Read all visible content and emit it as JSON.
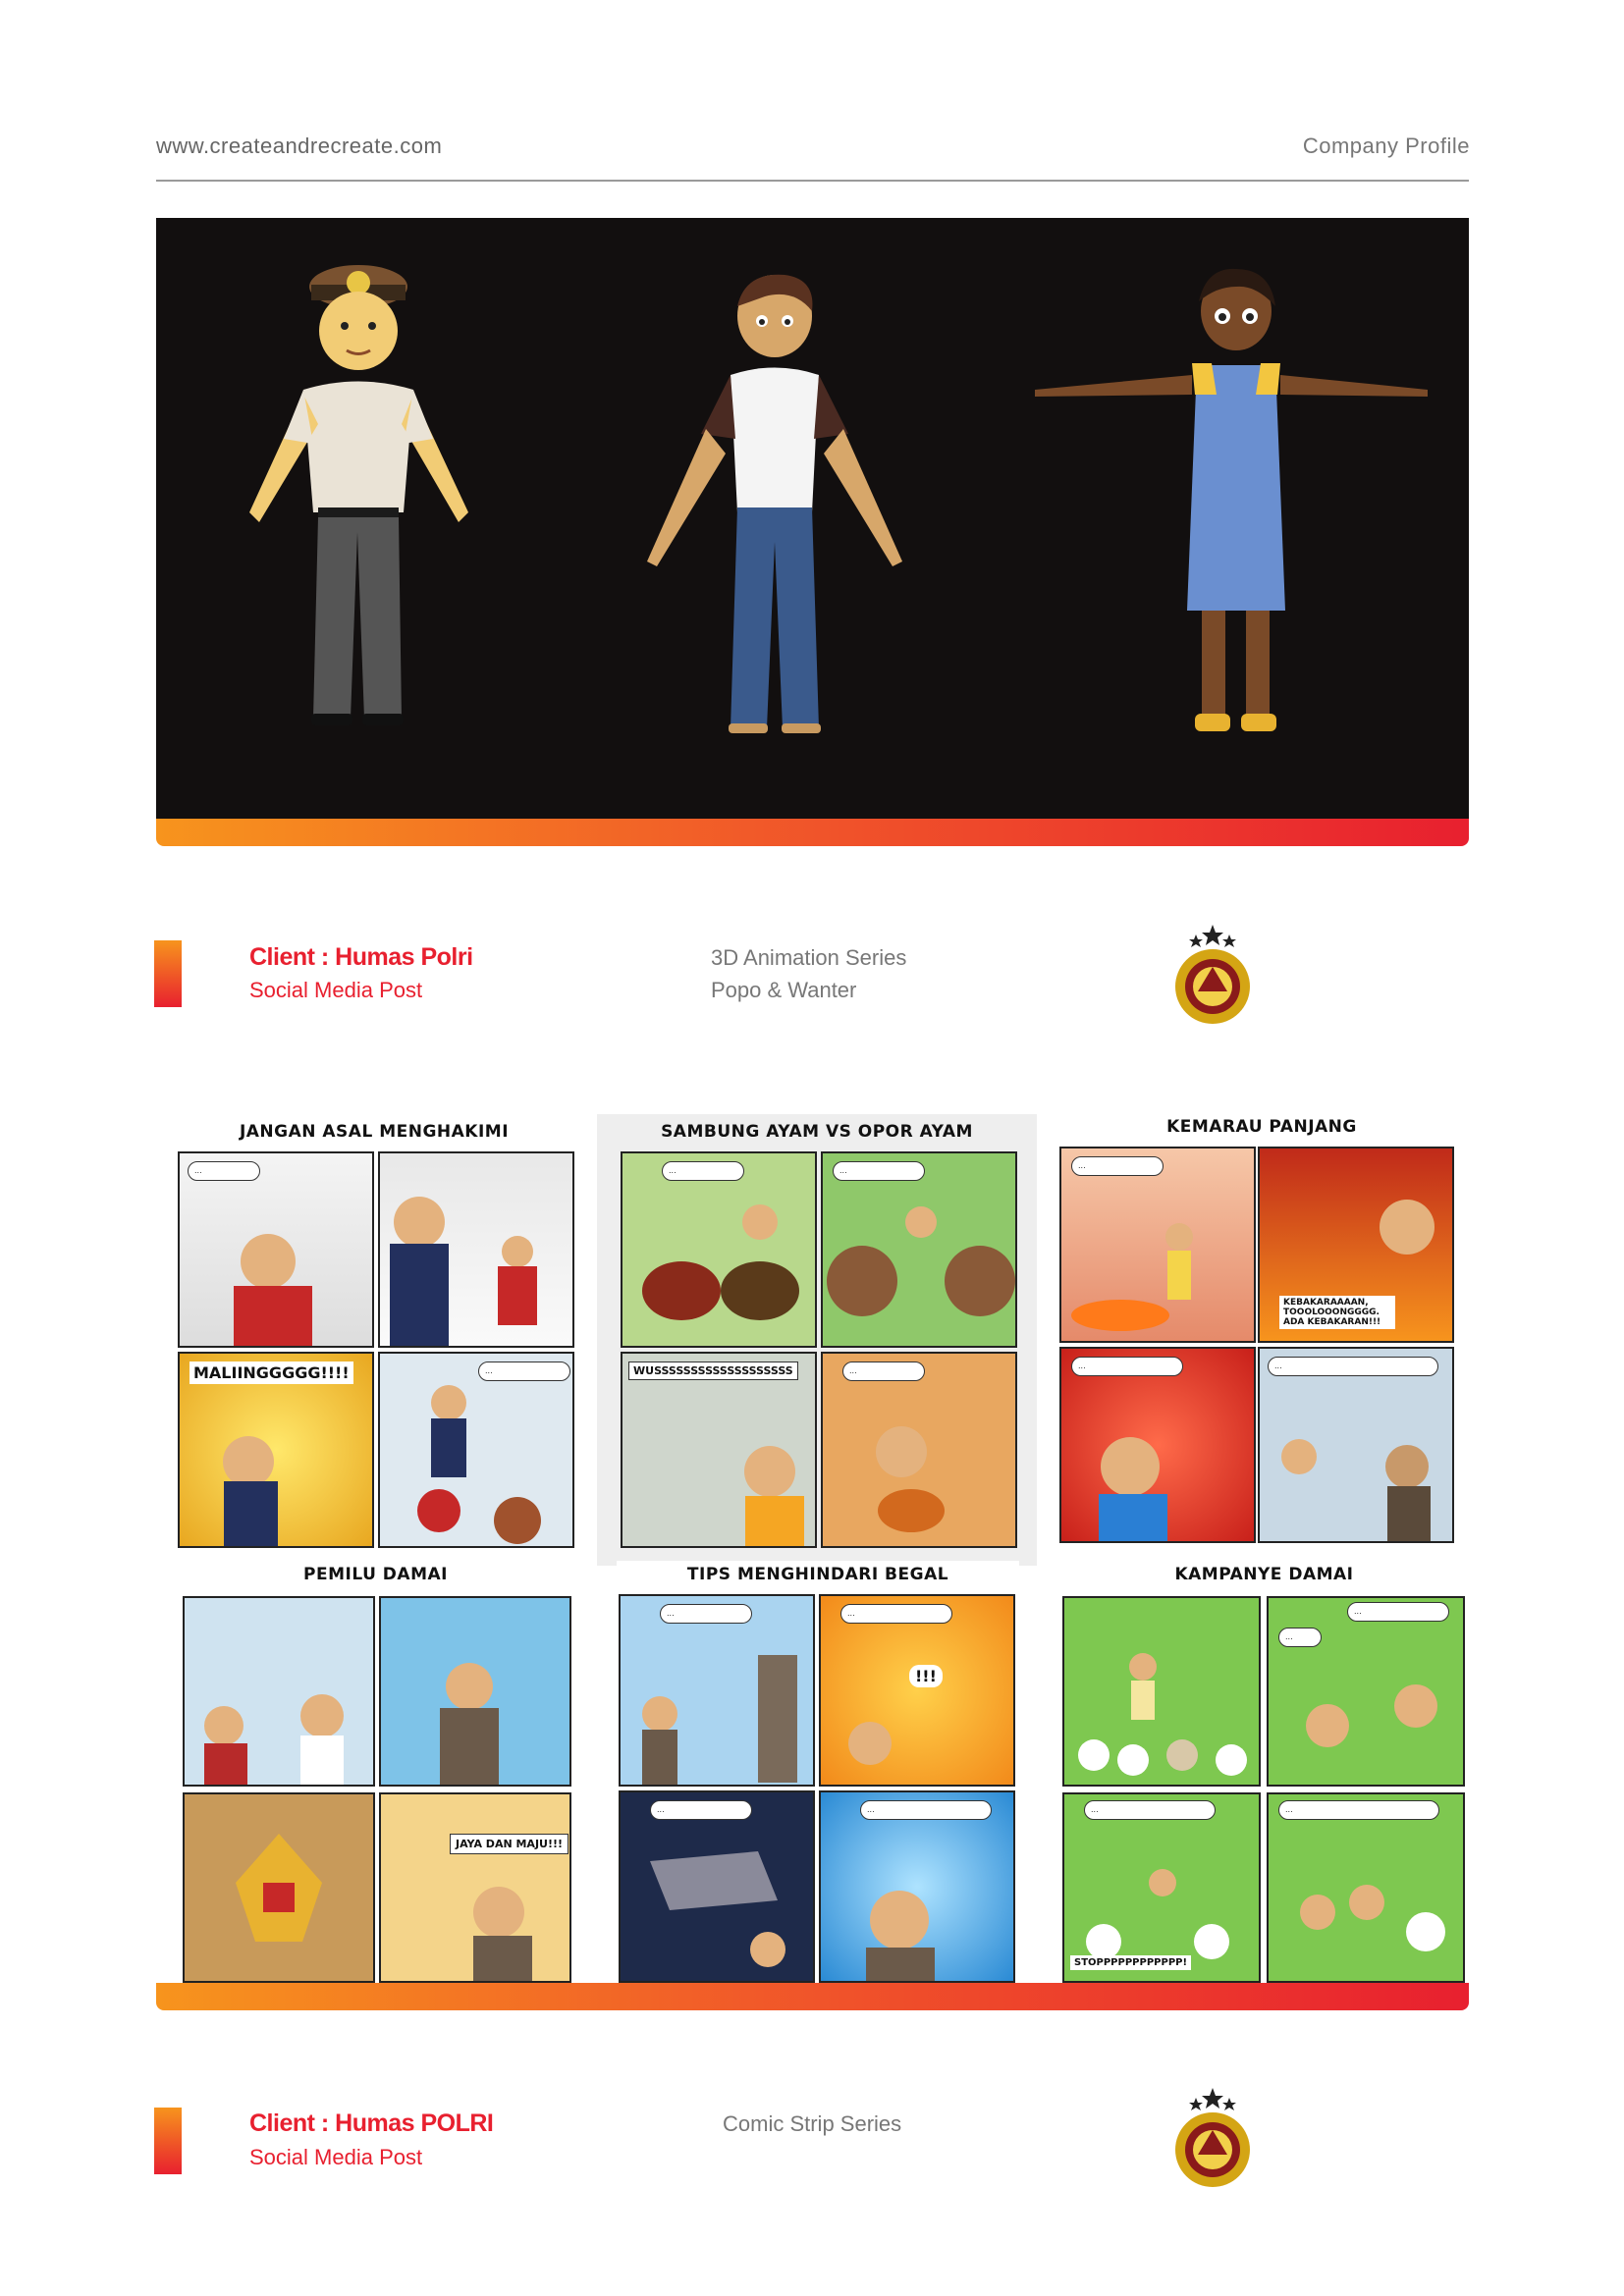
{
  "header": {
    "url": "www.createandrecreate.com",
    "section": "Company Profile"
  },
  "project1": {
    "client": "Client : Humas Polri",
    "category": "Social Media Post",
    "series_type": "3D Animation Series",
    "series_name": "Popo & Wanter"
  },
  "comics": [
    {
      "title": "JANGAN ASAL MENGHAKIMI",
      "shout": "MALIINGGGGG!!!!"
    },
    {
      "title": "SAMBUNG AYAM VS OPOR AYAM",
      "shout": "WUSSSSSSSSSSSSSSSSSSS"
    },
    {
      "title": "KEMARAU PANJANG",
      "shout": "KEBAKARAAAAN, TOOOLOOONGGGG. ADA KEBAKARAN!!!"
    },
    {
      "title": "PEMILU DAMAI",
      "shout": "JAYA DAN MAJU!!!"
    },
    {
      "title": "TIPS MENGHINDARI BEGAL",
      "shout": "!!!"
    },
    {
      "title": "KAMPANYE DAMAI",
      "shout": "STOPPPPPPPPPPPP!"
    }
  ],
  "project2": {
    "client": "Client : Humas POLRI",
    "category": "Social Media Post",
    "series_type": "Comic Strip Series"
  },
  "colors": {
    "accent_orange": "#f7941d",
    "accent_red": "#e8202f",
    "police_gold": "#d4a514"
  }
}
